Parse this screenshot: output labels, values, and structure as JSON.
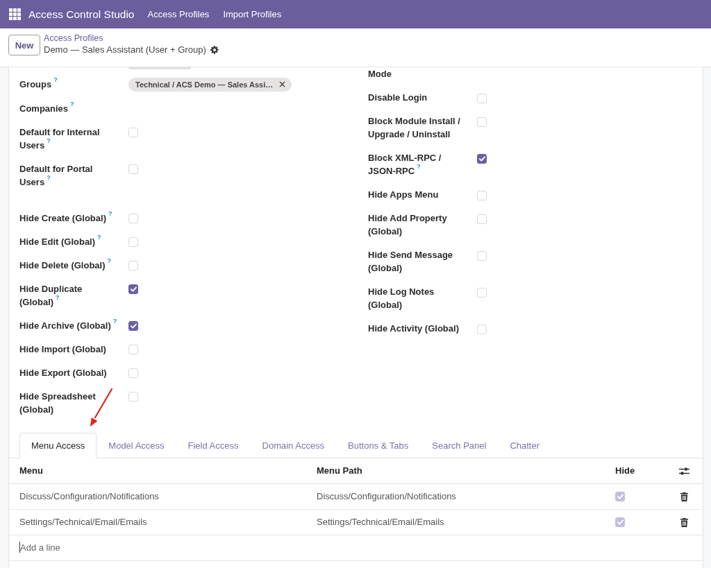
{
  "navbar": {
    "app_name": "Access Control Studio",
    "menu": [
      "Access Profiles",
      "Import Profiles"
    ]
  },
  "control_panel": {
    "new_button": "New",
    "breadcrumb": "Access Profiles",
    "record_title": "Demo — Sales Assistant (User + Group)"
  },
  "form": {
    "left_column": [
      {
        "fields": [
          {
            "kind": "tags",
            "label": "Groups",
            "hint": "?",
            "tags": [
              "Technical / ACS Demo — Sales Assi…"
            ]
          },
          {
            "kind": "empty",
            "label": "Companies",
            "hint": "?"
          },
          {
            "kind": "checkbox",
            "label": "Default for Internal Users",
            "hint": "?",
            "checked": false
          },
          {
            "kind": "checkbox",
            "label": "Default for Portal Users",
            "hint": "?",
            "checked": false
          }
        ]
      },
      {
        "fields": [
          {
            "kind": "checkbox",
            "label": "Hide Create (Global)",
            "hint": "?",
            "checked": false
          },
          {
            "kind": "checkbox",
            "label": "Hide Edit (Global)",
            "hint": "?",
            "checked": false
          },
          {
            "kind": "checkbox",
            "label": "Hide Delete (Global)",
            "hint": "?",
            "checked": false
          },
          {
            "kind": "checkbox",
            "label": "Hide Duplicate (Global)",
            "hint": "?",
            "checked": true
          },
          {
            "kind": "checkbox",
            "label": "Hide Archive (Global)",
            "hint": "?",
            "checked": true
          },
          {
            "kind": "checkbox",
            "label": "Hide Import (Global)",
            "checked": false
          },
          {
            "kind": "checkbox",
            "label": "Hide Export (Global)",
            "checked": false
          },
          {
            "kind": "checkbox",
            "label": "Hide Spreadsheet (Global)",
            "checked": false
          }
        ]
      }
    ],
    "right_column": [
      {
        "fields": [
          {
            "kind": "label",
            "label": "Mode"
          },
          {
            "kind": "checkbox",
            "label": "Disable Login",
            "checked": false
          },
          {
            "kind": "checkbox",
            "label": "Block Module Install / Upgrade / Uninstall",
            "checked": false
          },
          {
            "kind": "checkbox",
            "label": "Block XML-RPC / JSON-RPC",
            "hint": "?",
            "checked": true
          },
          {
            "kind": "checkbox",
            "label": "Hide Apps Menu",
            "checked": false
          },
          {
            "kind": "checkbox",
            "label": "Hide Add Property (Global)",
            "checked": false
          },
          {
            "kind": "checkbox",
            "label": "Hide Send Message (Global)",
            "checked": false
          },
          {
            "kind": "checkbox",
            "label": "Hide Log Notes (Global)",
            "checked": false
          },
          {
            "kind": "checkbox",
            "label": "Hide Activity (Global)",
            "checked": false
          }
        ]
      }
    ]
  },
  "tabs": [
    {
      "label": "Menu Access",
      "selected": true
    },
    {
      "label": "Model Access",
      "selected": false
    },
    {
      "label": "Field Access",
      "selected": false
    },
    {
      "label": "Domain Access",
      "selected": false
    },
    {
      "label": "Buttons & Tabs",
      "selected": false
    },
    {
      "label": "Search Panel",
      "selected": false
    },
    {
      "label": "Chatter",
      "selected": false
    }
  ],
  "table": {
    "columns": [
      "Menu",
      "Menu Path",
      "Hide"
    ],
    "rows": [
      {
        "menu": "Discuss/Configuration/Notifications",
        "menu_path": "Discuss/Configuration/Notifications",
        "hide": {
          "checked": true,
          "disabled": true
        }
      },
      {
        "menu": "Settings/Technical/Email/Emails",
        "menu_path": "Settings/Technical/Email/Emails",
        "hide": {
          "checked": true,
          "disabled": true
        }
      }
    ],
    "add_line": "Add a line"
  }
}
